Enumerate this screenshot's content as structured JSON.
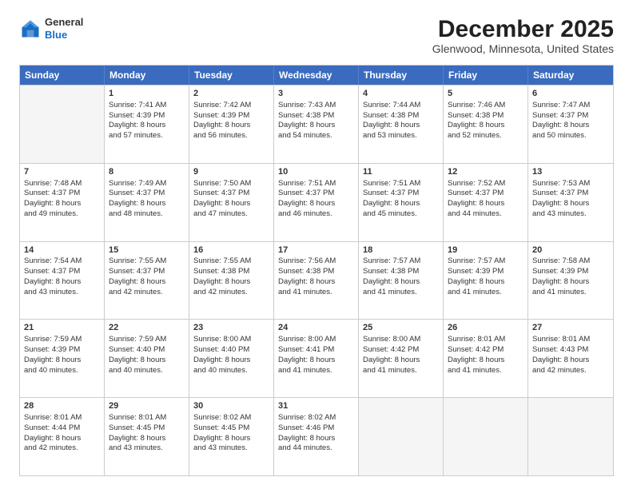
{
  "logo": {
    "general": "General",
    "blue": "Blue"
  },
  "title": "December 2025",
  "subtitle": "Glenwood, Minnesota, United States",
  "weekdays": [
    "Sunday",
    "Monday",
    "Tuesday",
    "Wednesday",
    "Thursday",
    "Friday",
    "Saturday"
  ],
  "rows": [
    [
      {
        "day": "",
        "info": "",
        "empty": true
      },
      {
        "day": "1",
        "info": "Sunrise: 7:41 AM\nSunset: 4:39 PM\nDaylight: 8 hours\nand 57 minutes."
      },
      {
        "day": "2",
        "info": "Sunrise: 7:42 AM\nSunset: 4:39 PM\nDaylight: 8 hours\nand 56 minutes."
      },
      {
        "day": "3",
        "info": "Sunrise: 7:43 AM\nSunset: 4:38 PM\nDaylight: 8 hours\nand 54 minutes."
      },
      {
        "day": "4",
        "info": "Sunrise: 7:44 AM\nSunset: 4:38 PM\nDaylight: 8 hours\nand 53 minutes."
      },
      {
        "day": "5",
        "info": "Sunrise: 7:46 AM\nSunset: 4:38 PM\nDaylight: 8 hours\nand 52 minutes."
      },
      {
        "day": "6",
        "info": "Sunrise: 7:47 AM\nSunset: 4:37 PM\nDaylight: 8 hours\nand 50 minutes."
      }
    ],
    [
      {
        "day": "7",
        "info": "Sunrise: 7:48 AM\nSunset: 4:37 PM\nDaylight: 8 hours\nand 49 minutes."
      },
      {
        "day": "8",
        "info": "Sunrise: 7:49 AM\nSunset: 4:37 PM\nDaylight: 8 hours\nand 48 minutes."
      },
      {
        "day": "9",
        "info": "Sunrise: 7:50 AM\nSunset: 4:37 PM\nDaylight: 8 hours\nand 47 minutes."
      },
      {
        "day": "10",
        "info": "Sunrise: 7:51 AM\nSunset: 4:37 PM\nDaylight: 8 hours\nand 46 minutes."
      },
      {
        "day": "11",
        "info": "Sunrise: 7:51 AM\nSunset: 4:37 PM\nDaylight: 8 hours\nand 45 minutes."
      },
      {
        "day": "12",
        "info": "Sunrise: 7:52 AM\nSunset: 4:37 PM\nDaylight: 8 hours\nand 44 minutes."
      },
      {
        "day": "13",
        "info": "Sunrise: 7:53 AM\nSunset: 4:37 PM\nDaylight: 8 hours\nand 43 minutes."
      }
    ],
    [
      {
        "day": "14",
        "info": "Sunrise: 7:54 AM\nSunset: 4:37 PM\nDaylight: 8 hours\nand 43 minutes."
      },
      {
        "day": "15",
        "info": "Sunrise: 7:55 AM\nSunset: 4:37 PM\nDaylight: 8 hours\nand 42 minutes."
      },
      {
        "day": "16",
        "info": "Sunrise: 7:55 AM\nSunset: 4:38 PM\nDaylight: 8 hours\nand 42 minutes."
      },
      {
        "day": "17",
        "info": "Sunrise: 7:56 AM\nSunset: 4:38 PM\nDaylight: 8 hours\nand 41 minutes."
      },
      {
        "day": "18",
        "info": "Sunrise: 7:57 AM\nSunset: 4:38 PM\nDaylight: 8 hours\nand 41 minutes."
      },
      {
        "day": "19",
        "info": "Sunrise: 7:57 AM\nSunset: 4:39 PM\nDaylight: 8 hours\nand 41 minutes."
      },
      {
        "day": "20",
        "info": "Sunrise: 7:58 AM\nSunset: 4:39 PM\nDaylight: 8 hours\nand 41 minutes."
      }
    ],
    [
      {
        "day": "21",
        "info": "Sunrise: 7:59 AM\nSunset: 4:39 PM\nDaylight: 8 hours\nand 40 minutes."
      },
      {
        "day": "22",
        "info": "Sunrise: 7:59 AM\nSunset: 4:40 PM\nDaylight: 8 hours\nand 40 minutes."
      },
      {
        "day": "23",
        "info": "Sunrise: 8:00 AM\nSunset: 4:40 PM\nDaylight: 8 hours\nand 40 minutes."
      },
      {
        "day": "24",
        "info": "Sunrise: 8:00 AM\nSunset: 4:41 PM\nDaylight: 8 hours\nand 41 minutes."
      },
      {
        "day": "25",
        "info": "Sunrise: 8:00 AM\nSunset: 4:42 PM\nDaylight: 8 hours\nand 41 minutes."
      },
      {
        "day": "26",
        "info": "Sunrise: 8:01 AM\nSunset: 4:42 PM\nDaylight: 8 hours\nand 41 minutes."
      },
      {
        "day": "27",
        "info": "Sunrise: 8:01 AM\nSunset: 4:43 PM\nDaylight: 8 hours\nand 42 minutes."
      }
    ],
    [
      {
        "day": "28",
        "info": "Sunrise: 8:01 AM\nSunset: 4:44 PM\nDaylight: 8 hours\nand 42 minutes."
      },
      {
        "day": "29",
        "info": "Sunrise: 8:01 AM\nSunset: 4:45 PM\nDaylight: 8 hours\nand 43 minutes."
      },
      {
        "day": "30",
        "info": "Sunrise: 8:02 AM\nSunset: 4:45 PM\nDaylight: 8 hours\nand 43 minutes."
      },
      {
        "day": "31",
        "info": "Sunrise: 8:02 AM\nSunset: 4:46 PM\nDaylight: 8 hours\nand 44 minutes."
      },
      {
        "day": "",
        "info": "",
        "empty": true
      },
      {
        "day": "",
        "info": "",
        "empty": true
      },
      {
        "day": "",
        "info": "",
        "empty": true
      }
    ]
  ]
}
